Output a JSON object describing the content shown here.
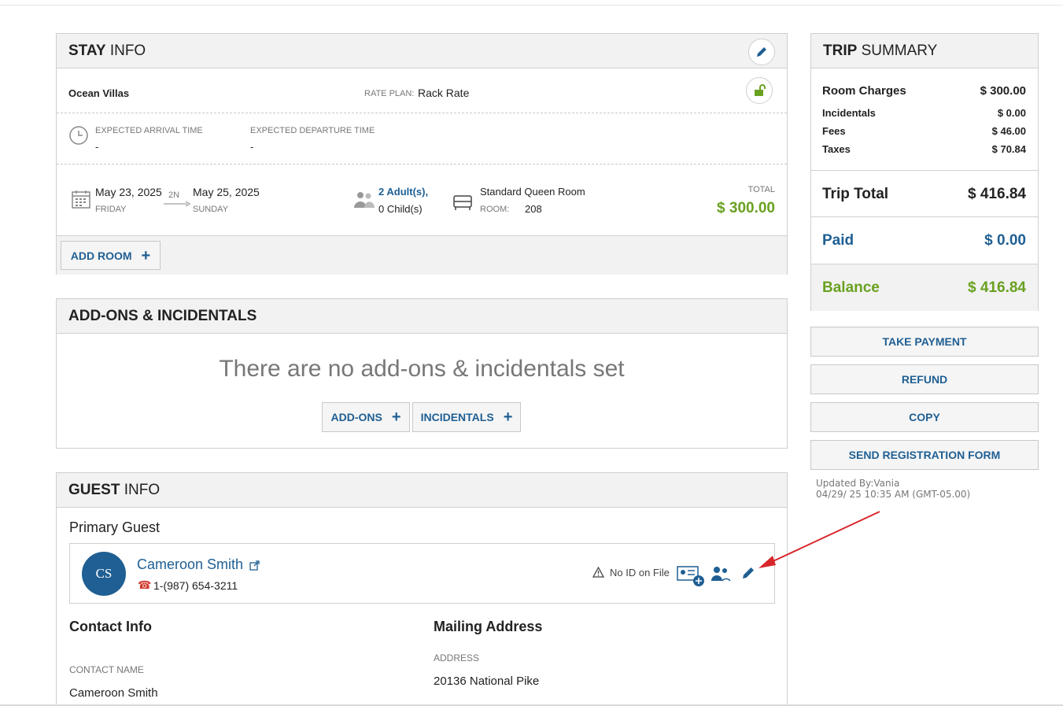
{
  "stay": {
    "title_bold": "STAY",
    "title_rest": "INFO",
    "property": "Ocean Villas",
    "rate_plan_label": "RATE PLAN:",
    "rate_plan": "Rack Rate",
    "arrival_label": "EXPECTED ARRIVAL TIME",
    "arrival_value": "-",
    "departure_label": "EXPECTED DEPARTURE TIME",
    "departure_value": "-",
    "checkin_date": "May 23, 2025",
    "checkin_day": "FRIDAY",
    "nights": "2N",
    "checkout_date": "May 25, 2025",
    "checkout_day": "SUNDAY",
    "adults": "2 Adult(s),",
    "children": "0 Child(s)",
    "room_type": "Standard Queen Room",
    "room_label": "ROOM:",
    "room_number": "208",
    "total_label": "TOTAL",
    "total_value": "$ 300.00",
    "add_room_label": "ADD ROOM"
  },
  "addons": {
    "title": "ADD-ONS & INCIDENTALS",
    "empty_message": "There are no add-ons & incidentals set",
    "addons_button": "ADD-ONS",
    "incidentals_button": "INCIDENTALS"
  },
  "guest": {
    "title_bold": "GUEST",
    "title_rest": "INFO",
    "primary_label": "Primary Guest",
    "initials": "CS",
    "name": "Cameroon Smith",
    "phone": "1-(987) 654-3211",
    "id_status": "No ID on File",
    "contact_heading": "Contact Info",
    "contact_name_label": "CONTACT NAME",
    "contact_name": "Cameroon Smith",
    "mailing_heading": "Mailing Address",
    "address_label": "ADDRESS",
    "address": "20136 National Pike"
  },
  "summary": {
    "title_bold": "TRIP",
    "title_rest": "SUMMARY",
    "room_charges_label": "Room Charges",
    "room_charges": "$ 300.00",
    "incidentals_label": "Incidentals",
    "incidentals": "$ 0.00",
    "fees_label": "Fees",
    "fees": "$ 46.00",
    "taxes_label": "Taxes",
    "taxes": "$ 70.84",
    "trip_total_label": "Trip Total",
    "trip_total": "$ 416.84",
    "paid_label": "Paid",
    "paid": "$ 0.00",
    "balance_label": "Balance",
    "balance": "$ 416.84"
  },
  "actions": {
    "take_payment": "TAKE PAYMENT",
    "refund": "REFUND",
    "copy": "COPY",
    "send_registration": "SEND REGISTRATION FORM"
  },
  "audit": {
    "updated_by": "Updated By:Vania",
    "updated_at": "04/29/ 25 10:35 AM (GMT-05.00)"
  },
  "colors": {
    "accent_blue": "#1f5f93",
    "balance_green": "#6aa121",
    "annotation_arrow": "#d9262b",
    "phone_red": "#d23a2f"
  }
}
